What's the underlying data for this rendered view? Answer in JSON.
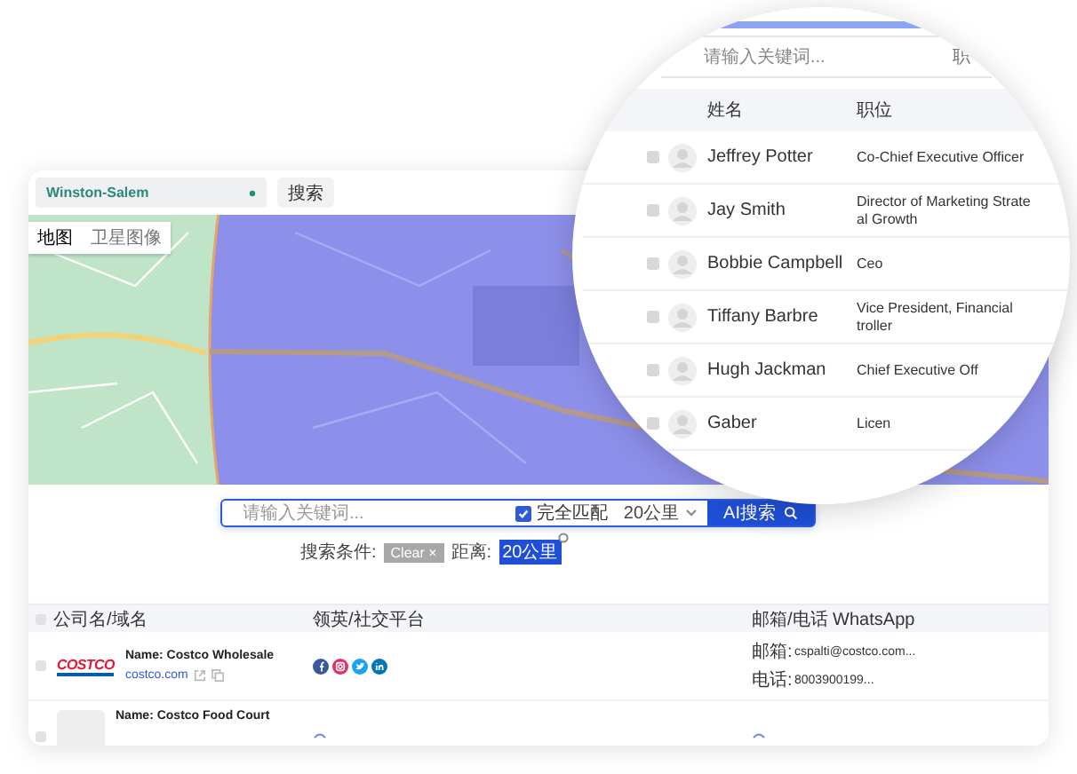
{
  "location_select": {
    "value": "Winston-Salem"
  },
  "search_button": "搜索",
  "map": {
    "tabs": [
      {
        "label": "地图",
        "selected": true
      },
      {
        "label": "卫星图像",
        "selected": false
      }
    ]
  },
  "search": {
    "placeholder": "请输入关键词...",
    "exact_match": {
      "label": "完全匹配",
      "checked": true
    },
    "distance": "20公里",
    "button": "AI搜索"
  },
  "filters": {
    "label": "搜索条件:",
    "clear": "Clear ×",
    "distance_label": "距离:",
    "distance_tag": "20公里"
  },
  "table": {
    "columns": [
      "公司名/域名",
      "领英/社交平台",
      "邮箱/电话 WhatsApp"
    ],
    "header_checked": false,
    "rows": [
      {
        "kind": "logo",
        "checked": false,
        "logo": "COSTCO",
        "name": "Name: Costco Wholesale",
        "domain": "costco.com",
        "socials": [
          {
            "kind": "facebook"
          },
          {
            "kind": "instagram"
          },
          {
            "kind": "twitter"
          },
          {
            "kind": "linkedin"
          }
        ],
        "email_label": "邮箱:",
        "email": "cspalti@costco.com...",
        "phone_label": "电话:",
        "phone": "8003900199..."
      },
      {
        "kind": "placeholder",
        "checked": false,
        "name": "Name: Costco Food Court"
      }
    ]
  },
  "magnifier": {
    "search_placeholder": "请输入关键词...",
    "search_extra": "职",
    "columns": [
      "姓名",
      "职位"
    ],
    "rows": [
      {
        "checked": false,
        "name": "Jeffrey Potter",
        "title": [
          "Co-Chief Executive Officer"
        ]
      },
      {
        "checked": false,
        "name": "Jay Smith",
        "title": [
          "Director of Marketing Strate",
          "al Growth"
        ]
      },
      {
        "checked": false,
        "name": "Bobbie Campbell",
        "title": [
          "Ceo"
        ]
      },
      {
        "checked": false,
        "name": "Tiffany Barbre",
        "title": [
          "Vice President, Financial",
          "troller"
        ]
      },
      {
        "checked": false,
        "name": "Hugh Jackman",
        "title": [
          "Chief Executive Off"
        ]
      },
      {
        "checked": false,
        "name": "Gaber",
        "title": [
          "Licen"
        ]
      }
    ]
  }
}
